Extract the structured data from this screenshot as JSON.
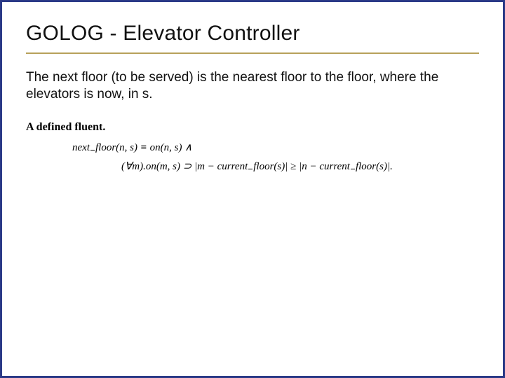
{
  "title": "GOLOG - Elevator Controller",
  "body": "The next floor (to be served) is the nearest floor to the floor, where the elevators is now, in s.",
  "fluent": {
    "heading": "A defined fluent.",
    "line1_a": "next",
    "line1_b": "floor(n, s) ≡ on(n, s) ∧",
    "line2_a": "(∀m).on(m, s) ⊃ |m − current",
    "line2_b": "floor(s)| ≥ |n − current",
    "line2_c": "floor(s)|."
  }
}
